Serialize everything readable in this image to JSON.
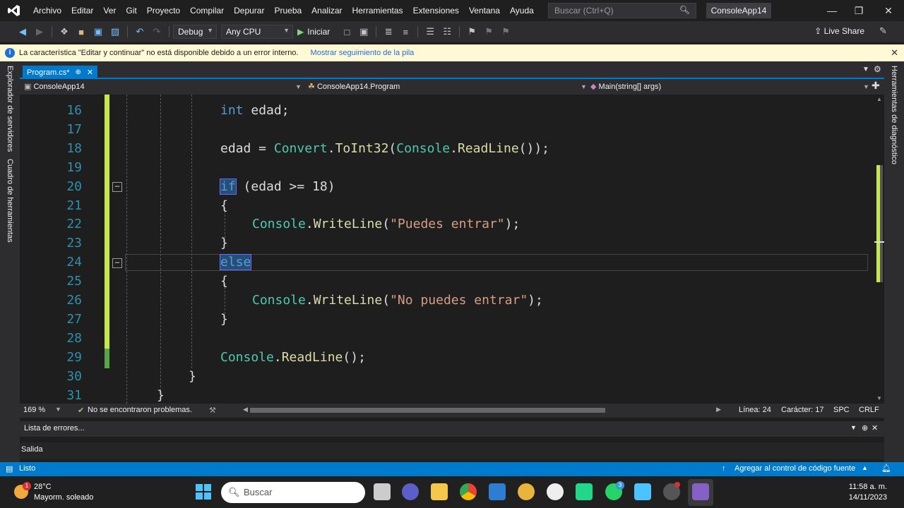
{
  "menu": {
    "items": [
      "Archivo",
      "Editar",
      "Ver",
      "Git",
      "Proyecto",
      "Compilar",
      "Depurar",
      "Prueba",
      "Analizar",
      "Herramientas",
      "Extensiones",
      "Ventana",
      "Ayuda"
    ],
    "search_placeholder": "Buscar (Ctrl+Q)",
    "app_title": "ConsoleApp14"
  },
  "toolbar": {
    "config": "Debug",
    "platform": "Any CPU",
    "start_label": "Iniciar",
    "liveshare_label": "Live Share"
  },
  "infobar": {
    "message": "La característica \"Editar y continuar\" no está disponible debido a un error interno.",
    "link": "Mostrar seguimiento de la pila"
  },
  "side": {
    "left_1": "Explorador de servidores",
    "left_2": "Cuadro de herramientas",
    "right_1": "Herramientas de diagnóstico"
  },
  "tabs": {
    "active": "Program.cs*"
  },
  "nav": {
    "project": "ConsoleApp14",
    "class": "ConsoleApp14.Program",
    "member": "Main(string[] args)"
  },
  "editor": {
    "line_numbers": [
      "16",
      "17",
      "18",
      "19",
      "20",
      "21",
      "22",
      "23",
      "24",
      "25",
      "26",
      "27",
      "28",
      "29",
      "30",
      "31"
    ],
    "current_line": 24,
    "lines": {
      "l16_kw": "int",
      "l16_rest": " edad;",
      "l18_a": "edad = ",
      "l18_ty1": "Convert",
      "l18_dot1": ".",
      "l18_me1": "ToInt32",
      "l18_p1": "(",
      "l18_ty2": "Console",
      "l18_dot2": ".",
      "l18_me2": "ReadLine",
      "l18_end": "());",
      "l20_kw": "if",
      "l20_rest": " (edad >= 18)",
      "open_brace": "{",
      "close_brace": "}",
      "l22_ty": "Console",
      "l22_dot": ".",
      "l22_me": "WriteLine",
      "l22_p": "(",
      "l22_str": "\"Puedes entrar\"",
      "l22_end": ");",
      "l24_kw": "else",
      "l26_ty": "Console",
      "l26_dot": ".",
      "l26_me": "WriteLine",
      "l26_p": "(",
      "l26_str": "\"No puedes entrar\"",
      "l26_end": ");",
      "l29_ty": "Console",
      "l29_dot": ".",
      "l29_me": "ReadLine",
      "l29_end": "();"
    }
  },
  "editor_status": {
    "zoom": "169 %",
    "problems": "No se encontraron problemas.",
    "line": "Línea: 24",
    "char": "Carácter: 17",
    "spc": "SPC",
    "eol": "CRLF"
  },
  "panels": {
    "errors": "Lista de errores...",
    "output": "Salida"
  },
  "statusbar": {
    "ready": "Listo",
    "source_control": "Agregar al control de código fuente"
  },
  "taskbar": {
    "weather_temp": "28°C",
    "weather_desc": "Mayorm. soleado",
    "weather_badge": "1",
    "search": "Buscar",
    "time": "11:58 a. m.",
    "date": "14/11/2023",
    "whatsapp_badge": "3"
  }
}
